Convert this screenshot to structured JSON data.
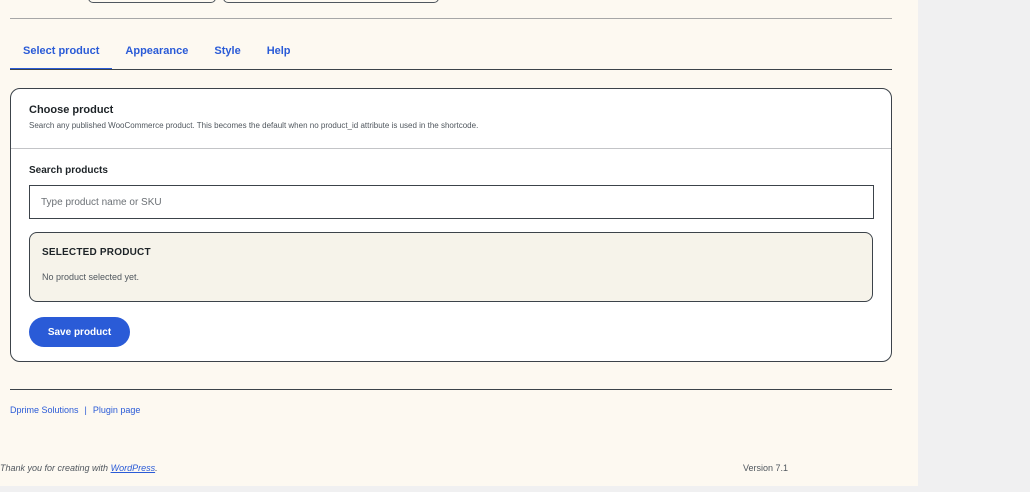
{
  "tabs": [
    {
      "label": "Select product",
      "active": true
    },
    {
      "label": "Appearance",
      "active": false
    },
    {
      "label": "Style",
      "active": false
    },
    {
      "label": "Help",
      "active": false
    }
  ],
  "card": {
    "title": "Choose product",
    "description": "Search any published WooCommerce product. This becomes the default when no product_id attribute is used in the shortcode.",
    "search_label": "Search products",
    "search_placeholder": "Type product name or SKU",
    "search_value": "",
    "selected_title": "SELECTED PRODUCT",
    "selected_empty": "No product selected yet.",
    "save_label": "Save product"
  },
  "footer": {
    "link1": "Dprime Solutions",
    "separator": "|",
    "link2": "Plugin page",
    "thanks_prefix": "Thank you for creating with",
    "thanks_link": "WordPress",
    "thanks_suffix": ".",
    "version": "Version 7.1"
  },
  "colors": {
    "accent": "#2a5bd7",
    "page_bg": "#fdf9f1",
    "selected_bg": "#f6f3ea",
    "admin_bg": "#f0f0f1"
  }
}
